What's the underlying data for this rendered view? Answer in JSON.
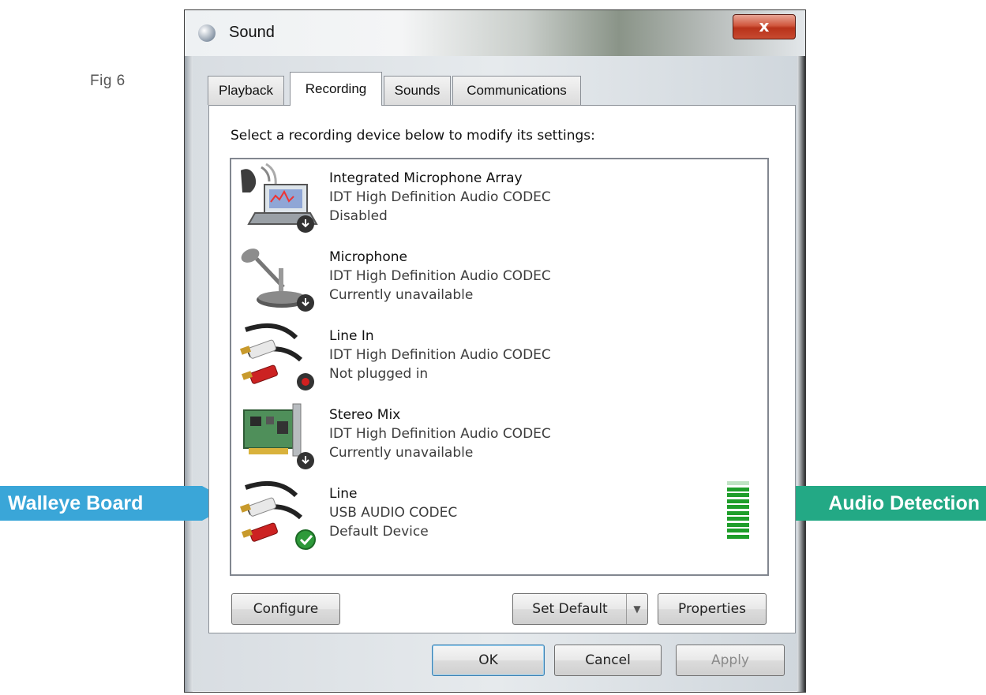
{
  "figure_label": "Fig 6",
  "window": {
    "title": "Sound",
    "close_label": "x"
  },
  "tabs": [
    {
      "label": "Playback",
      "active": false
    },
    {
      "label": "Recording",
      "active": true
    },
    {
      "label": "Sounds",
      "active": false
    },
    {
      "label": "Communications",
      "active": false
    }
  ],
  "instruction": "Select a recording device below to modify its settings:",
  "devices": [
    {
      "name": "Integrated Microphone Array",
      "codec": "IDT High Definition Audio CODEC",
      "status": "Disabled",
      "icon": "laptop-microphone-icon",
      "badge": "disabled-down-arrow"
    },
    {
      "name": "Microphone",
      "codec": "IDT High Definition Audio CODEC",
      "status": "Currently unavailable",
      "icon": "desk-microphone-icon",
      "badge": "unavailable-down-arrow"
    },
    {
      "name": "Line In",
      "codec": "IDT High Definition Audio CODEC",
      "status": "Not plugged in",
      "icon": "rca-cable-icon",
      "badge": "unplugged-red-dot"
    },
    {
      "name": "Stereo Mix",
      "codec": "IDT High Definition Audio CODEC",
      "status": "Currently unavailable",
      "icon": "sound-card-icon",
      "badge": "unavailable-down-arrow"
    },
    {
      "name": "Line",
      "codec": "USB AUDIO  CODEC",
      "status": "Default Device",
      "icon": "rca-cable-icon",
      "badge": "default-green-check"
    }
  ],
  "level_meter": {
    "bars": 10,
    "lit_fraction": 0.9,
    "color": "#1e9e2a"
  },
  "buttons": {
    "configure": "Configure",
    "set_default": "Set Default",
    "properties": "Properties",
    "ok": "OK",
    "cancel": "Cancel",
    "apply": "Apply"
  },
  "callouts": {
    "left": {
      "text": "Walleye Board",
      "color": "#3aa6d8"
    },
    "right": {
      "text": "Audio Detection",
      "color": "#23a985"
    }
  }
}
